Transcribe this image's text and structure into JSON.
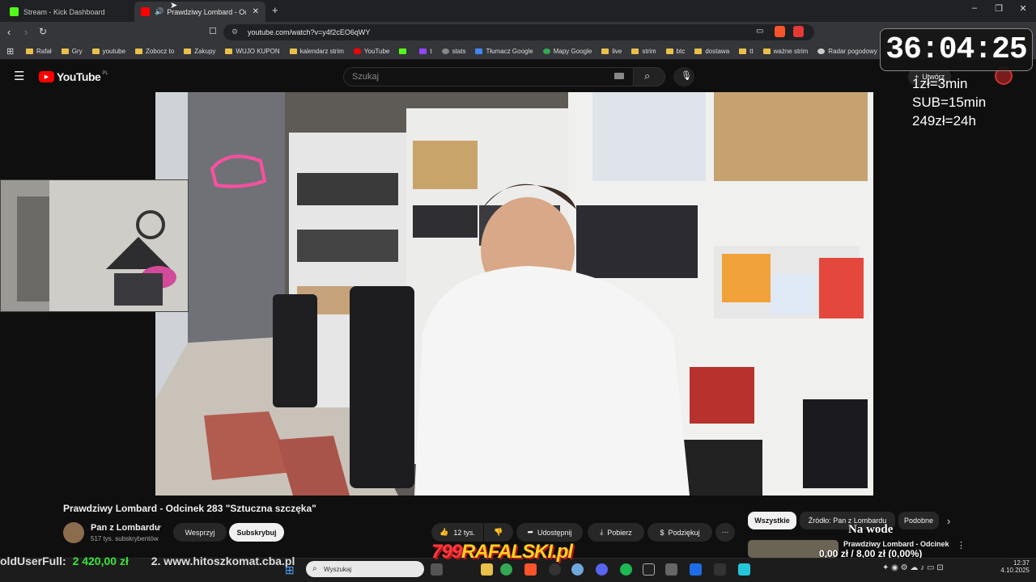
{
  "browser": {
    "tabs": [
      {
        "title": "Stream - Kick Dashboard",
        "active": false
      },
      {
        "title": "Prawdziwy Lombard - Odcinek",
        "active": true
      }
    ],
    "url": "youtube.com/watch?v=y4f2cEO6qWY",
    "bookmarks": [
      "Rafał",
      "Gry",
      "youtube",
      "Zobocz to",
      "Zakupy",
      "WUJO KUPON",
      "kalendarz strim",
      "YouTube",
      "t",
      "stats",
      "Tłumacz Google",
      "Mapy Google",
      "live",
      "strim",
      "btc",
      "dostawa",
      "tt",
      "ważne strim",
      "Radar pogodowy"
    ]
  },
  "youtube": {
    "logo": "YouTube",
    "logo_region": "PL",
    "search_placeholder": "Szukaj",
    "create_label": "Utwórz",
    "video_title": "Prawdziwy Lombard - Odcinek 283 \"Sztuczna szczęka\"",
    "channel_name": "Pan z Lombardu",
    "subscribers": "517 tys. subskrybentów",
    "support_label": "Wesprzyj",
    "subscribe_label": "Subskrybuj",
    "likes": "12 tys.",
    "share_label": "Udostępnij",
    "download_label": "Pobierz",
    "thanks_label": "Podziękuj",
    "filter_chips": [
      "Wszystkie",
      "Źródło: Pan z Lombardu",
      "Podobne"
    ],
    "next_video_title": "Prawdziwy Lombard - Odcinek"
  },
  "overlay": {
    "timer": "36:04:25",
    "rates": [
      "1zł=3min",
      "SUB=15min",
      "249zł=24h"
    ],
    "na_wode_label": "Na wode",
    "na_wode_value": "0,00 zł / 8,00 zł (0,00%)",
    "ticker_label": "oldUserFull:",
    "ticker_amount": "2 420,00 zł",
    "ticker_link": "2. www.hitoszkomat.cba.pl",
    "brand": "RAFALSKI.pl",
    "brand_prefix": "799"
  },
  "taskbar": {
    "search_placeholder": "Wyszukaj",
    "time": "12:37",
    "date": "4.10.2025"
  },
  "colors": {
    "youtube_red": "#ff0000",
    "kick_green": "#53fc18",
    "ticker_green": "#39e53b",
    "brand_yellow": "#ffd21f"
  }
}
